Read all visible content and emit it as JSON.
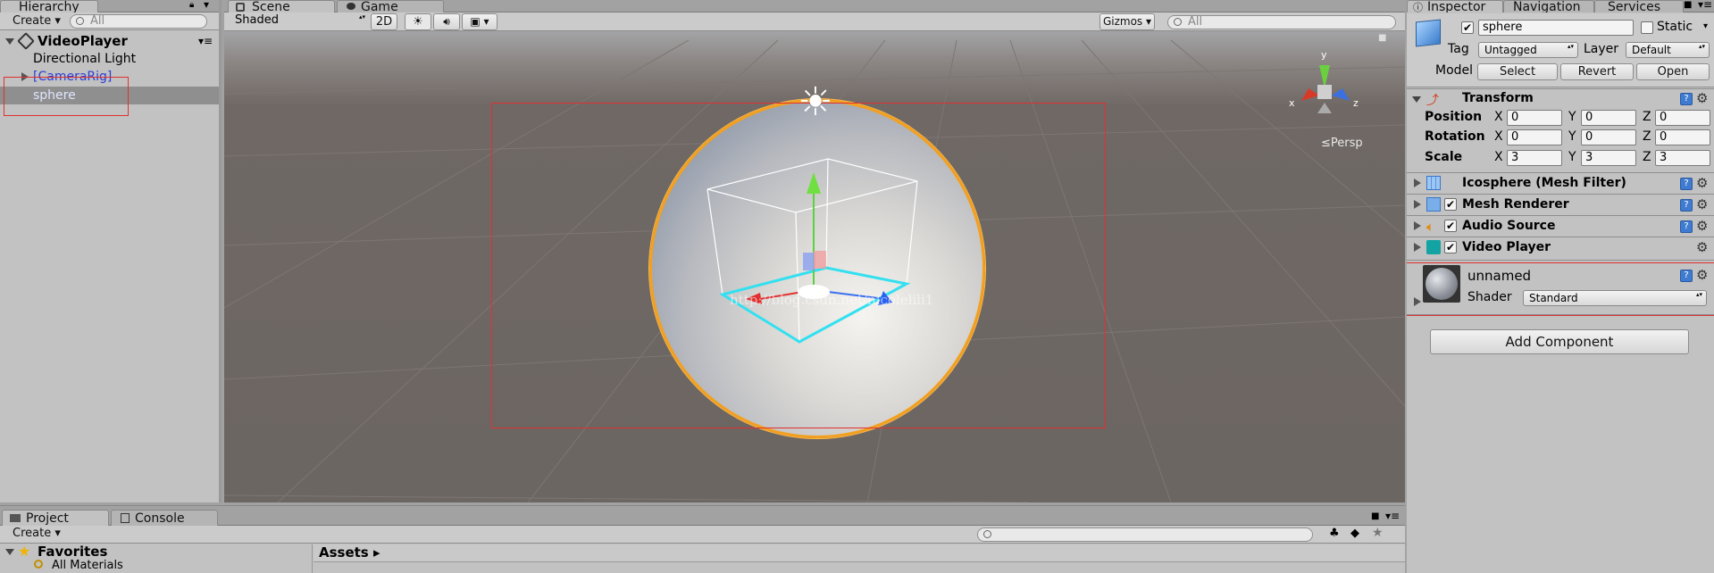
{
  "hierarchy": {
    "tab_label": "Hierarchy",
    "create_label": "Create ▾",
    "search_placeholder": "All",
    "scene_name": "VideoPlayer",
    "items": [
      {
        "label": "Directional Light"
      },
      {
        "label": "[CameraRig]"
      },
      {
        "label": "sphere"
      }
    ]
  },
  "scene_view": {
    "tabs": [
      {
        "label": "Scene"
      },
      {
        "label": "Game"
      }
    ],
    "shading_mode": "Shaded",
    "mode_2d": "2D",
    "gizmos_label": "Gizmos",
    "search_placeholder": "All",
    "persp_label": "≤Persp",
    "axis_y": "y",
    "axis_x": "x",
    "axis_z": "z",
    "watermark": "http://blog.csdn.net/nicolelili1"
  },
  "inspector": {
    "tabs": [
      {
        "label": "Inspector"
      },
      {
        "label": "Navigation"
      },
      {
        "label": "Services"
      }
    ],
    "object_name": "sphere",
    "static_label": "Static",
    "tag_label": "Tag",
    "tag_value": "Untagged",
    "layer_label": "Layer",
    "layer_value": "Default",
    "model_label": "Model",
    "model_buttons": {
      "select": "Select",
      "revert": "Revert",
      "open": "Open"
    },
    "transform": {
      "title": "Transform",
      "rows": [
        {
          "label": "Position",
          "x": "0",
          "y": "0",
          "z": "0"
        },
        {
          "label": "Rotation",
          "x": "0",
          "y": "0",
          "z": "0"
        },
        {
          "label": "Scale",
          "x": "3",
          "y": "3",
          "z": "3"
        }
      ]
    },
    "components": [
      {
        "title": "Icosphere (Mesh Filter)"
      },
      {
        "title": "Mesh Renderer"
      },
      {
        "title": "Audio Source"
      },
      {
        "title": "Video Player"
      }
    ],
    "material": {
      "name": "unnamed",
      "shader_label": "Shader",
      "shader_value": "Standard"
    },
    "add_component_label": "Add Component",
    "axis_labels": {
      "x": "X",
      "y": "Y",
      "z": "Z"
    }
  },
  "project": {
    "tabs": [
      {
        "label": "Project"
      },
      {
        "label": "Console"
      }
    ],
    "create_label": "Create ▾",
    "favorites_label": "Favorites",
    "favorites_items": [
      {
        "label": "All Materials"
      }
    ],
    "breadcrumb": "Assets ▸"
  }
}
